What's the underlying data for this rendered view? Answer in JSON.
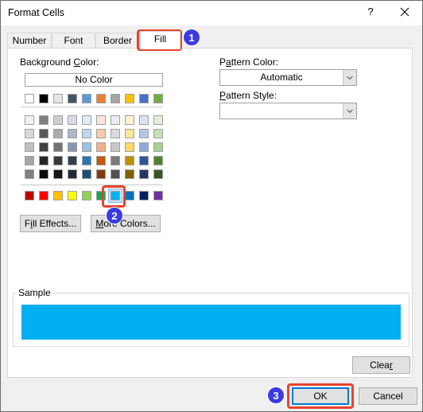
{
  "window": {
    "title": "Format Cells",
    "help_label": "?",
    "close_icon": "close-icon"
  },
  "tabs": [
    {
      "label": "Number",
      "active": false
    },
    {
      "label": "Font",
      "active": false
    },
    {
      "label": "Border",
      "active": false
    },
    {
      "label": "Fill",
      "active": true
    }
  ],
  "fill": {
    "background_color_label_pre": "Background ",
    "background_color_label_u": "C",
    "background_color_label_post": "olor:",
    "no_color_label": "No Color",
    "theme_row": [
      "#ffffff",
      "#000000",
      "#e7e6e6",
      "#44546a",
      "#5b9bd5",
      "#ed7d31",
      "#a5a5a5",
      "#ffc000",
      "#4472c4",
      "#70ad47"
    ],
    "tint_rows": [
      [
        "#f2f2f2",
        "#808080",
        "#d0cece",
        "#d6dce4",
        "#ddebf7",
        "#fce4d6",
        "#ededed",
        "#fff2cc",
        "#d9e1f2",
        "#e2efda"
      ],
      [
        "#d9d9d9",
        "#595959",
        "#aeaaaa",
        "#acb9ca",
        "#bdd7ee",
        "#f8cbad",
        "#dbdbdb",
        "#ffe699",
        "#b4c6e7",
        "#c6e0b4"
      ],
      [
        "#bfbfbf",
        "#404040",
        "#757171",
        "#8497b0",
        "#9bc2e6",
        "#f4b084",
        "#c9c9c9",
        "#ffd966",
        "#8ea9db",
        "#a9d08e"
      ],
      [
        "#a6a6a6",
        "#262626",
        "#3a3838",
        "#333f4f",
        "#2f75b5",
        "#c65911",
        "#7b7b7b",
        "#bf8f00",
        "#305496",
        "#548235"
      ],
      [
        "#808080",
        "#0d0d0d",
        "#161616",
        "#222b35",
        "#1f4e78",
        "#833c0c",
        "#525252",
        "#806000",
        "#203764",
        "#375623"
      ]
    ],
    "standard_row": [
      "#c00000",
      "#ff0000",
      "#ffc000",
      "#ffff00",
      "#92d050",
      "#00b050",
      "#00b0f0",
      "#0070c0",
      "#002060",
      "#7030a0"
    ],
    "selected_standard_index": 6,
    "fill_effects_pre": "F",
    "fill_effects_u": "i",
    "fill_effects_post": "ll Effects...",
    "more_colors_u": "M",
    "more_colors_post": "ore Colors...",
    "pattern_color_pre": "P",
    "pattern_color_u": "a",
    "pattern_color_post": "ttern Color:",
    "pattern_color_value": "Automatic",
    "pattern_style_u": "P",
    "pattern_style_post": "attern Style:",
    "pattern_style_value": "",
    "sample_label": "Sample",
    "sample_color": "#00b0f0",
    "clear_pre": "Clea",
    "clear_u": "r"
  },
  "footer": {
    "ok_label": "OK",
    "cancel_label": "Cancel"
  },
  "annotations": {
    "badge1": "1",
    "badge2": "2",
    "badge3": "3",
    "highlight_color": "#e8432a",
    "badge_color": "#3b3be0"
  }
}
